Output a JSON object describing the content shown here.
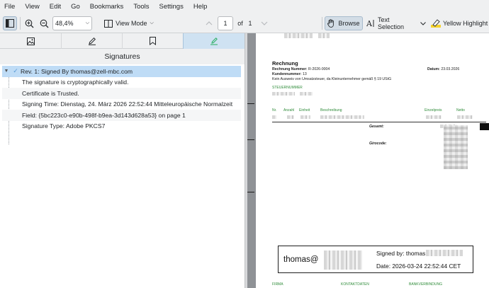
{
  "menu": [
    "File",
    "View",
    "Edit",
    "Go",
    "Bookmarks",
    "Tools",
    "Settings",
    "Help"
  ],
  "toolbar": {
    "zoom_value": "48,4%",
    "view_mode_label": "View Mode",
    "page_current": "1",
    "of_label": "of",
    "page_total": "1",
    "browse_label": "Browse",
    "text_selection_label": "Text Selection",
    "highlight_label": "Yellow Highlight"
  },
  "sidebar": {
    "tabs": [
      "thumbnails-icon",
      "annotations-icon",
      "bookmarks-icon",
      "signatures-icon"
    ],
    "active_tab": 3,
    "panel_title": "Signatures",
    "signature": {
      "label": "Rev. 1: Signed By thomas@zell-mbc.com",
      "details": [
        "The signature is cryptographically valid.",
        "Certificate is Trusted.",
        "Signing Time: Dienstag, 24. März 2026 22:52:44 Mitteleuropäische Normalzeit",
        "Field: {5bc223c0-e90b-498f-b9ea-3d143d628a53} on page 1",
        "Signature Type: Adobe PKCS7"
      ]
    }
  },
  "document": {
    "title": "Rechnung",
    "invoice_number_label": "Rechnung Nummer:",
    "invoice_number": "R-2026-0004",
    "customer_number_label": "Kundennummer:",
    "customer_number": "13",
    "tax_note": "Kein Ausweis von Umsatzsteuer, da Kleinunternehmer gemäß § 19 UStG",
    "date_label": "Datum:",
    "date": "23.03.2026",
    "tax_id_label": "STEUERNUMMER",
    "columns": [
      "Nr.",
      "Anzahl",
      "Einheit",
      "Beschreibung",
      "Einzelpreis",
      "Netto"
    ],
    "total_label": "Gesamt:",
    "giro_label": "Girocode:",
    "signature_field": {
      "name": "thomas@",
      "signed_by": "Signed by: thomas",
      "date": "Date: 2026-03-24 22:52:44 CET"
    },
    "footer": [
      "FIRMA",
      "KONTAKTDATEN",
      "BANKVERBINDUNG"
    ]
  },
  "colors": {
    "accent": "#3daee9",
    "selection": "#bfdcf6",
    "green_text": "#2f8c3a",
    "check": "#5a9bd5"
  }
}
